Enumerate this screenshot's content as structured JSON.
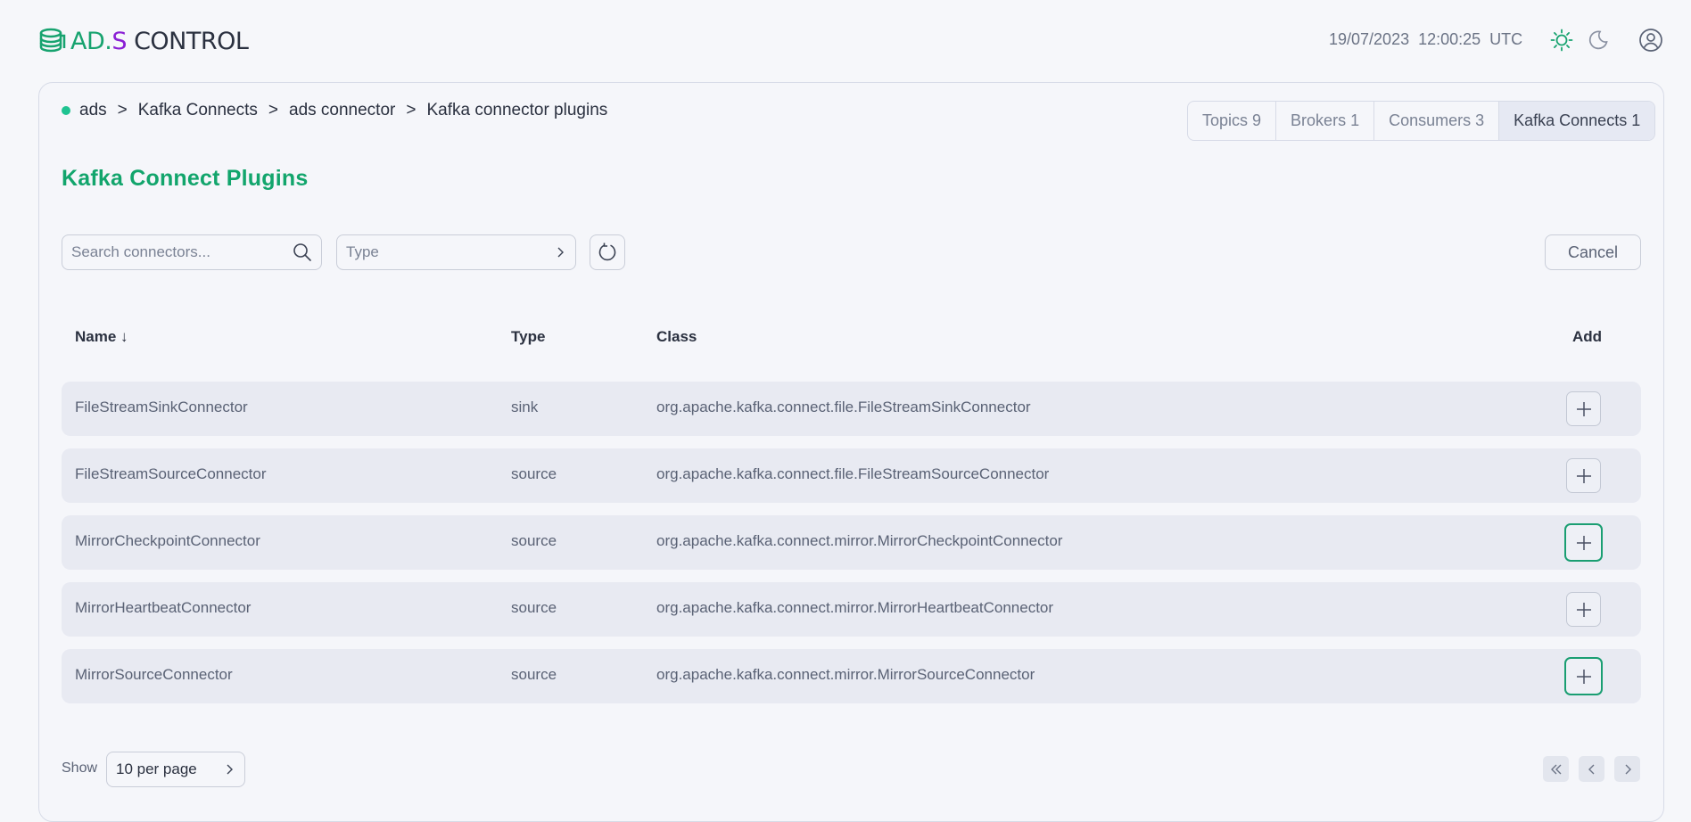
{
  "app": {
    "logo_ad": "AD",
    "logo_dot": ".",
    "logo_s": "S",
    "logo_control": " CONTROL",
    "date": "19/07/2023",
    "time": "12:00:25",
    "tz": "UTC"
  },
  "breadcrumb": [
    "ads",
    "Kafka Connects",
    "ads connector",
    "Kafka connector plugins"
  ],
  "tabs": [
    {
      "label": "Topics",
      "count": "9"
    },
    {
      "label": "Brokers",
      "count": "1"
    },
    {
      "label": "Consumers",
      "count": "3"
    },
    {
      "label": "Kafka Connects",
      "count": "1"
    }
  ],
  "page": {
    "title": "Kafka Connect Plugins",
    "search_placeholder": "Search connectors...",
    "type_placeholder": "Type",
    "cancel_label": "Cancel"
  },
  "table": {
    "headers": {
      "name": "Name",
      "sort_arrow": "↓",
      "type": "Type",
      "class": "Class",
      "add": "Add"
    },
    "rows": [
      {
        "name": "FileStreamSinkConnector",
        "type": "sink",
        "class": "org.apache.kafka.connect.file.FileStreamSinkConnector"
      },
      {
        "name": "FileStreamSourceConnector",
        "type": "source",
        "class": "org.apache.kafka.connect.file.FileStreamSourceConnector"
      },
      {
        "name": "MirrorCheckpointConnector",
        "type": "source",
        "class": "org.apache.kafka.connect.mirror.MirrorCheckpointConnector"
      },
      {
        "name": "MirrorHeartbeatConnector",
        "type": "source",
        "class": "org.apache.kafka.connect.mirror.MirrorHeartbeatConnector"
      },
      {
        "name": "MirrorSourceConnector",
        "type": "source",
        "class": "org.apache.kafka.connect.mirror.MirrorSourceConnector"
      }
    ]
  },
  "pagination": {
    "show_label": "Show",
    "per_page": "10 per page"
  },
  "colors": {
    "accent": "#12a56c",
    "status_dot": "#1fc391",
    "brand_purple": "#8a1fd4"
  },
  "icons": [
    "logo-icon",
    "sun-icon",
    "moon-icon",
    "user-icon",
    "search-icon",
    "chevron-right-icon",
    "refresh-icon",
    "plus-icon",
    "double-chevron-left-icon",
    "chevron-left-icon"
  ]
}
